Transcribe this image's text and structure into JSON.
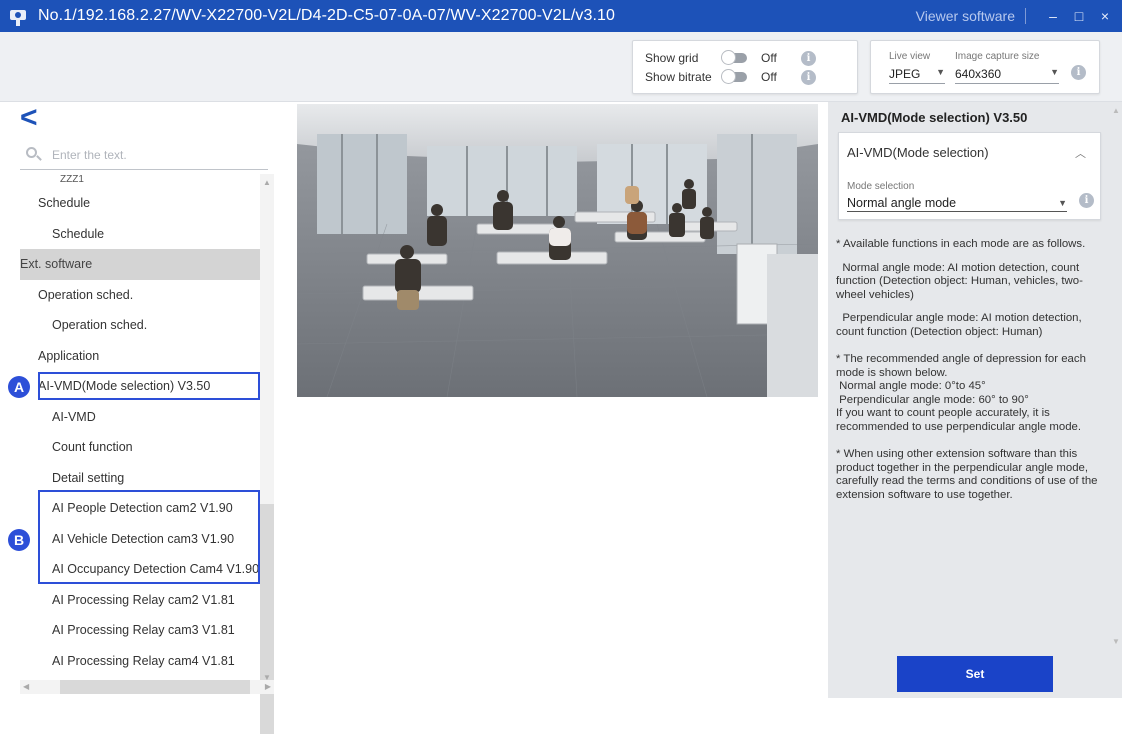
{
  "window": {
    "title": "No.1/192.168.2.27/WV-X22700-V2L/D4-2D-C5-07-0A-07/WV-X22700-V2L/v3.10",
    "viewer_label": "Viewer software",
    "minimize_glyph": "–",
    "maximize_glyph": "□",
    "close_glyph": "×"
  },
  "toolbar": {
    "show_grid": {
      "label": "Show grid",
      "state": "Off"
    },
    "show_bitrate": {
      "label": "Show bitrate",
      "state": "Off"
    },
    "live_view": {
      "label": "Live view",
      "value": "JPEG"
    },
    "image_capture_size": {
      "label": "Image capture size",
      "value": "640x360"
    },
    "info_glyph": "i"
  },
  "left": {
    "back_glyph": "<",
    "search_placeholder": "Enter the text.",
    "tree": [
      {
        "label": "ZZZ1",
        "level": "cut"
      },
      {
        "label": "Schedule",
        "level": "l1"
      },
      {
        "label": "Schedule",
        "level": "l2"
      },
      {
        "label": "Ext. software",
        "level": "l0",
        "selected": true
      },
      {
        "label": "Operation sched.",
        "level": "l1"
      },
      {
        "label": "Operation sched.",
        "level": "l2"
      },
      {
        "label": "Application",
        "level": "l1"
      },
      {
        "label": "AI-VMD(Mode selection) V3.50",
        "level": "l1"
      },
      {
        "label": "AI-VMD",
        "level": "l2"
      },
      {
        "label": "Count function",
        "level": "l2"
      },
      {
        "label": "Detail setting",
        "level": "l2"
      },
      {
        "label": "AI People Detection cam2 V1.90",
        "level": "l2"
      },
      {
        "label": "AI Vehicle Detection cam3 V1.90",
        "level": "l2"
      },
      {
        "label": "AI Occupancy Detection Cam4 V1.90",
        "level": "l2"
      },
      {
        "label": "AI Processing Relay cam2 V1.81",
        "level": "l2"
      },
      {
        "label": "AI Processing Relay cam3 V1.81",
        "level": "l2"
      },
      {
        "label": "AI Processing Relay cam4 V1.81",
        "level": "l2"
      }
    ],
    "marker_a": "A",
    "marker_b": "B"
  },
  "right": {
    "title": "AI-VMD(Mode selection) V3.50",
    "card_title": "AI-VMD(Mode selection)",
    "mode_label": "Mode selection",
    "mode_value": "Normal angle mode",
    "notes": [
      "* Available functions in each mode are as follows.",
      "  Normal angle mode: AI motion detection, count function (Detection object: Human, vehicles, two-wheel vehicles)",
      "  Perpendicular angle mode: AI motion detection, count function (Detection object: Human)",
      "* The recommended angle of depression for each mode is shown below.\n Normal angle mode: 0°to 45°\n Perpendicular angle mode: 60° to 90°\nIf you want to count people accurately, it is recommended to use perpendicular angle mode.",
      "* When using other extension software than this product together in the perpendicular angle mode, carefully read the terms and conditions of use of the extension software to use together."
    ],
    "set_label": "Set"
  }
}
